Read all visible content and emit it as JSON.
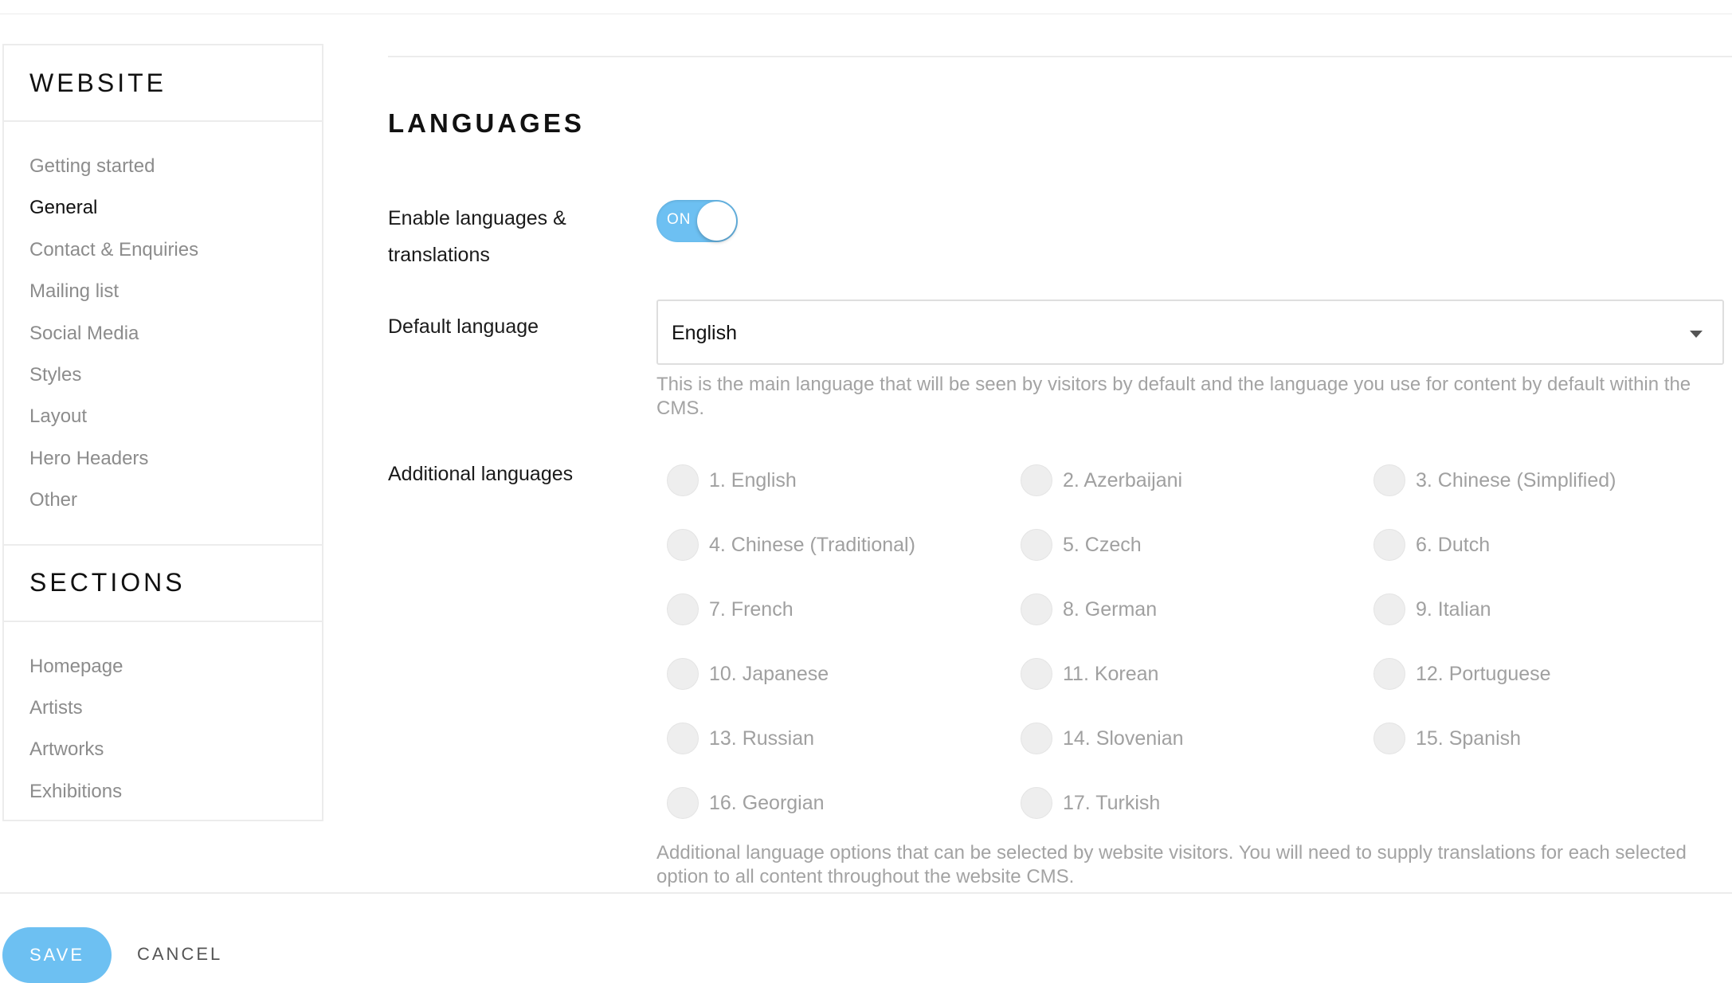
{
  "sidebar": {
    "website_title": "WEBSITE",
    "website_items": [
      {
        "label": "Getting started"
      },
      {
        "label": "General"
      },
      {
        "label": "Contact & Enquiries"
      },
      {
        "label": "Mailing list"
      },
      {
        "label": "Social Media"
      },
      {
        "label": "Styles"
      },
      {
        "label": "Layout"
      },
      {
        "label": "Hero Headers"
      },
      {
        "label": "Other"
      }
    ],
    "active_item": "General",
    "sections_title": "SECTIONS",
    "section_items": [
      {
        "label": "Homepage"
      },
      {
        "label": "Artists"
      },
      {
        "label": "Artworks"
      },
      {
        "label": "Exhibitions"
      }
    ]
  },
  "main": {
    "title": "LANGUAGES",
    "enable": {
      "label_line1": "Enable languages &",
      "label_line2": "translations",
      "toggle_text": "ON",
      "enabled": true
    },
    "default_language": {
      "label": "Default language",
      "value": "English",
      "help": "This is the main language that will be seen by visitors by default and the language you use for content by default within the CMS."
    },
    "additional": {
      "label": "Additional languages",
      "options": [
        "1. English",
        "2. Azerbaijani",
        "3. Chinese (Simplified)",
        "4. Chinese (Traditional)",
        "5. Czech",
        "6. Dutch",
        "7. French",
        "8. German",
        "9. Italian",
        "10. Japanese",
        "11. Korean",
        "12. Portuguese",
        "13. Russian",
        "14. Slovenian",
        "15. Spanish",
        "16. Georgian",
        "17. Turkish"
      ],
      "help": "Additional language options that can be selected by website visitors. You will need to supply translations for each selected option to all content throughout the website CMS."
    }
  },
  "footer": {
    "save_label": "SAVE",
    "cancel_label": "CANCEL"
  },
  "colors": {
    "accent": "#6dc0f2",
    "muted_text": "#a0a0a0",
    "border": "#ececec"
  }
}
